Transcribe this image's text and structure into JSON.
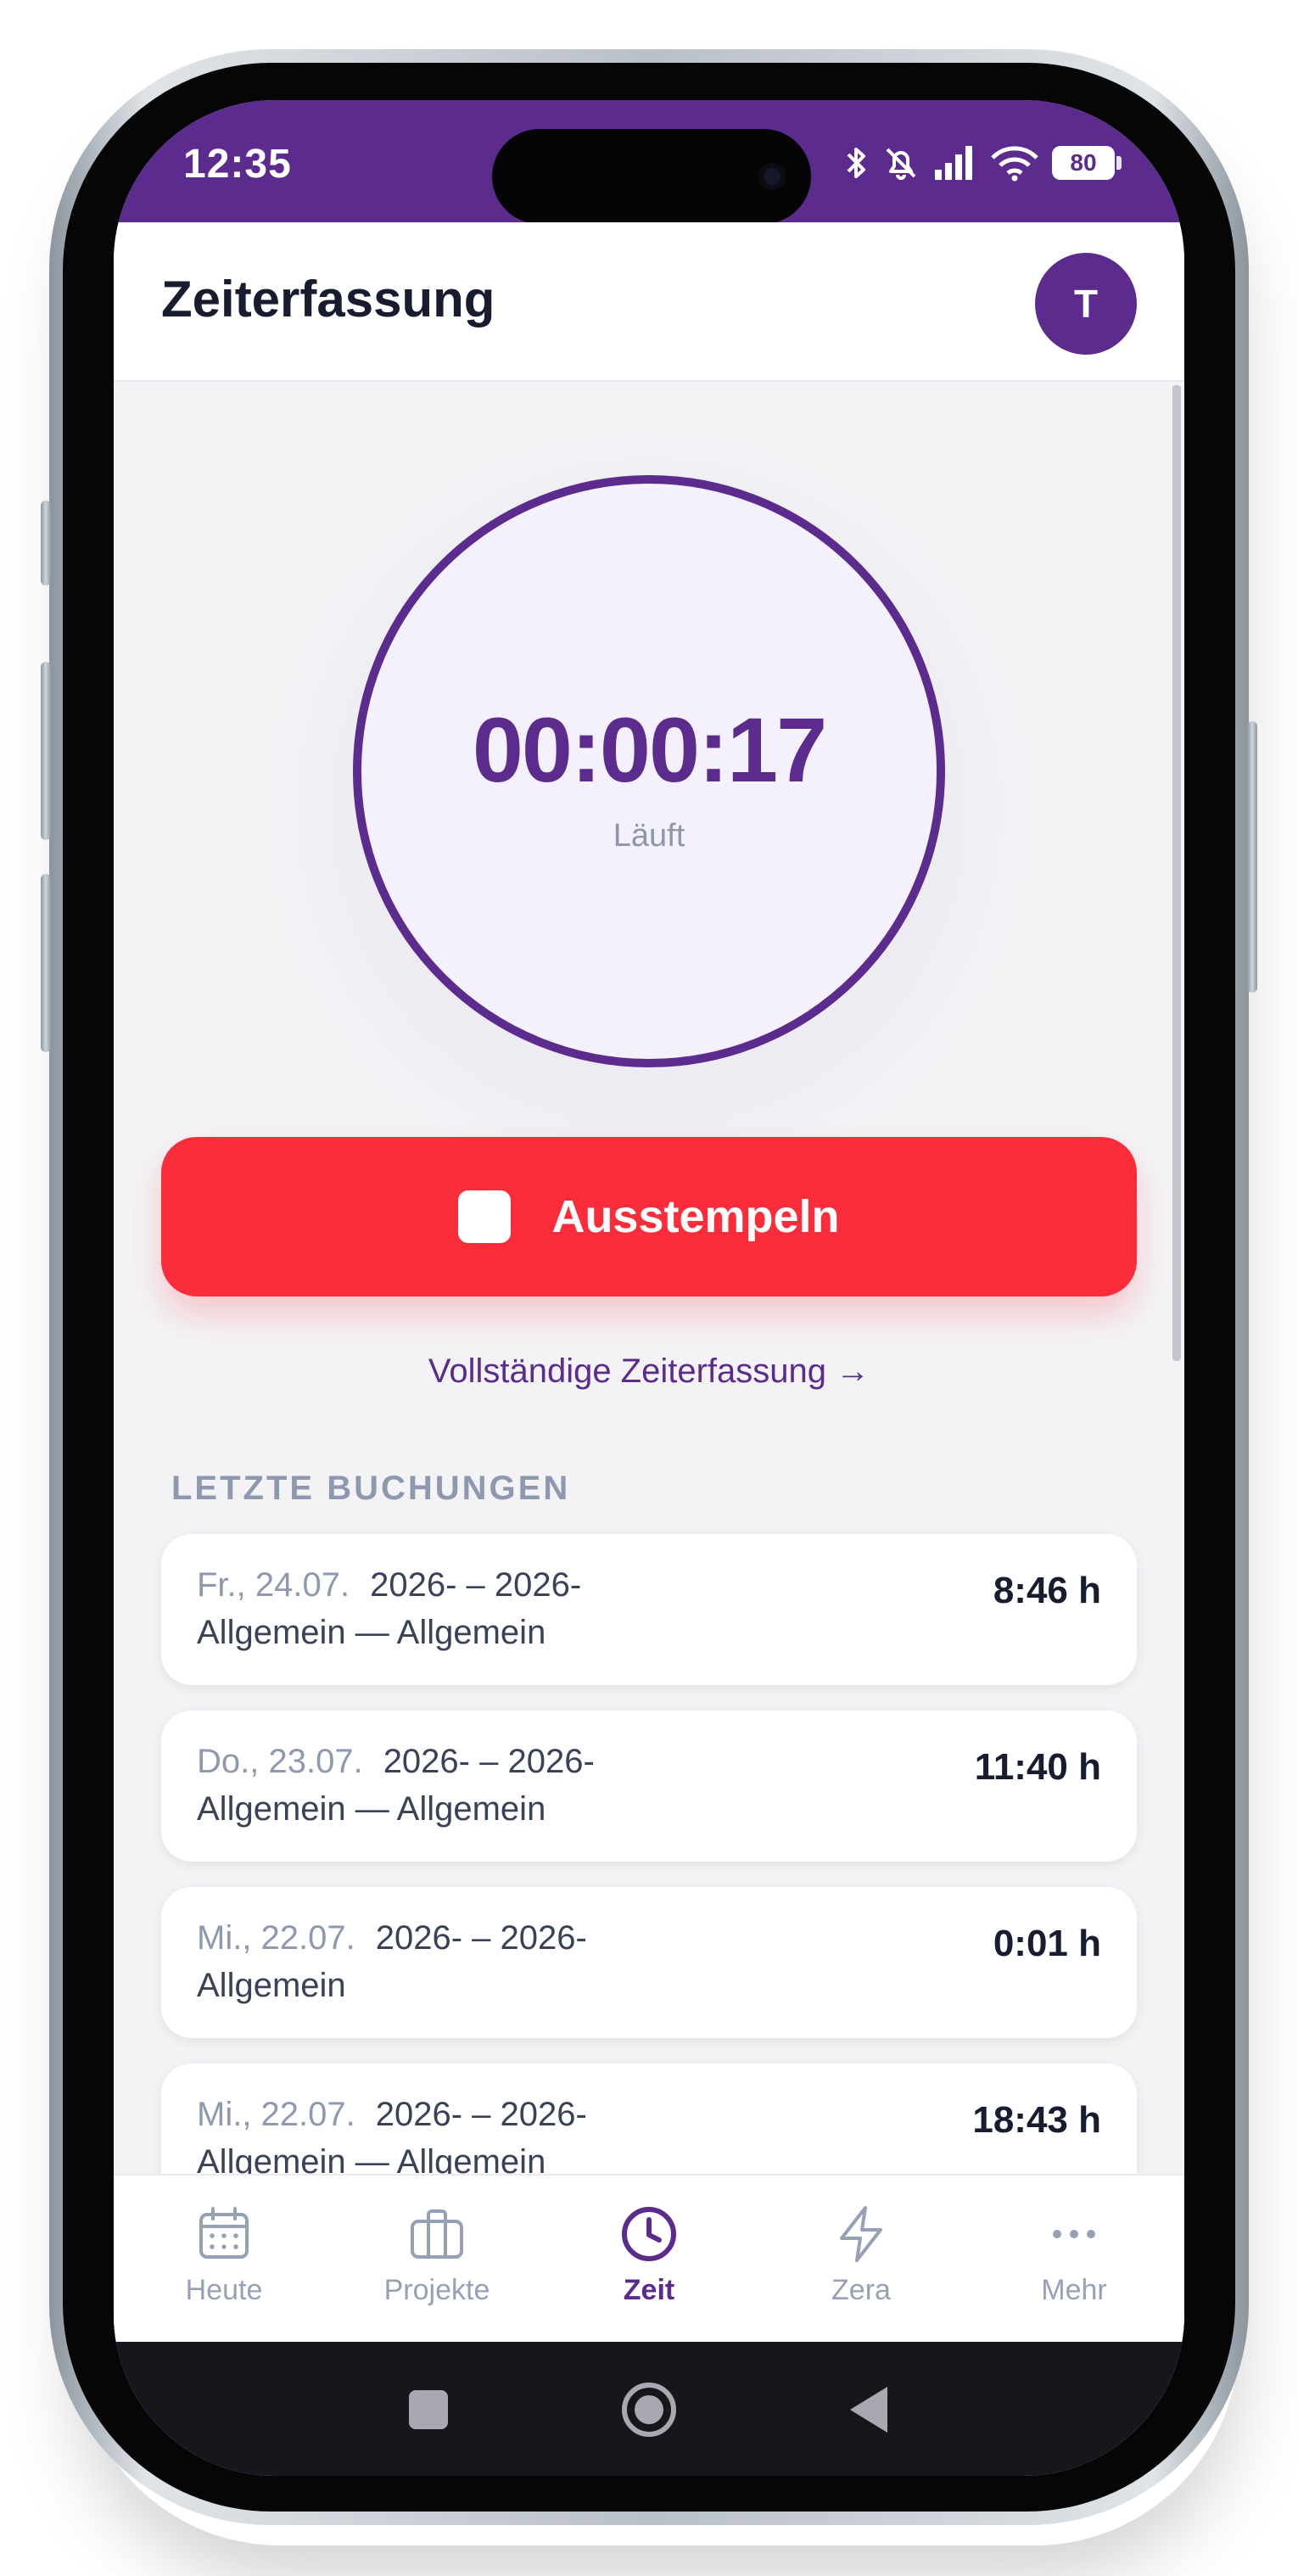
{
  "statusbar": {
    "time": "12:35",
    "battery": "80"
  },
  "header": {
    "title": "Zeiterfassung",
    "avatar_initial": "T"
  },
  "timer": {
    "value": "00:00:17",
    "status": "Läuft"
  },
  "actions": {
    "clock_out_label": "Ausstempeln",
    "full_link_label": "Vollständige Zeiterfassung →"
  },
  "recent": {
    "title": "LETZTE BUCHUNGEN",
    "entries": [
      {
        "date": "Fr., 24.07.",
        "range": "2026- – 2026-",
        "project": "Allgemein — Allgemein",
        "hours": "8:46 h"
      },
      {
        "date": "Do., 23.07.",
        "range": "2026- – 2026-",
        "project": "Allgemein — Allgemein",
        "hours": "11:40 h"
      },
      {
        "date": "Mi., 22.07.",
        "range": "2026- – 2026-",
        "project": "Allgemein",
        "hours": "0:01 h"
      },
      {
        "date": "Mi., 22.07.",
        "range": "2026- – 2026-",
        "project": "Allgemein — Allgemein",
        "hours": "18:43 h"
      }
    ]
  },
  "nav": {
    "items": [
      {
        "label": "Heute",
        "icon": "calendar-icon"
      },
      {
        "label": "Projekte",
        "icon": "briefcase-icon"
      },
      {
        "label": "Zeit",
        "icon": "clock-icon",
        "active": true
      },
      {
        "label": "Zera",
        "icon": "lightning-icon"
      },
      {
        "label": "Mehr",
        "icon": "more-dots-icon"
      }
    ]
  },
  "colors": {
    "brand": "#5b2c8d",
    "danger": "#fc2d3a",
    "muted": "#8e99b0"
  }
}
